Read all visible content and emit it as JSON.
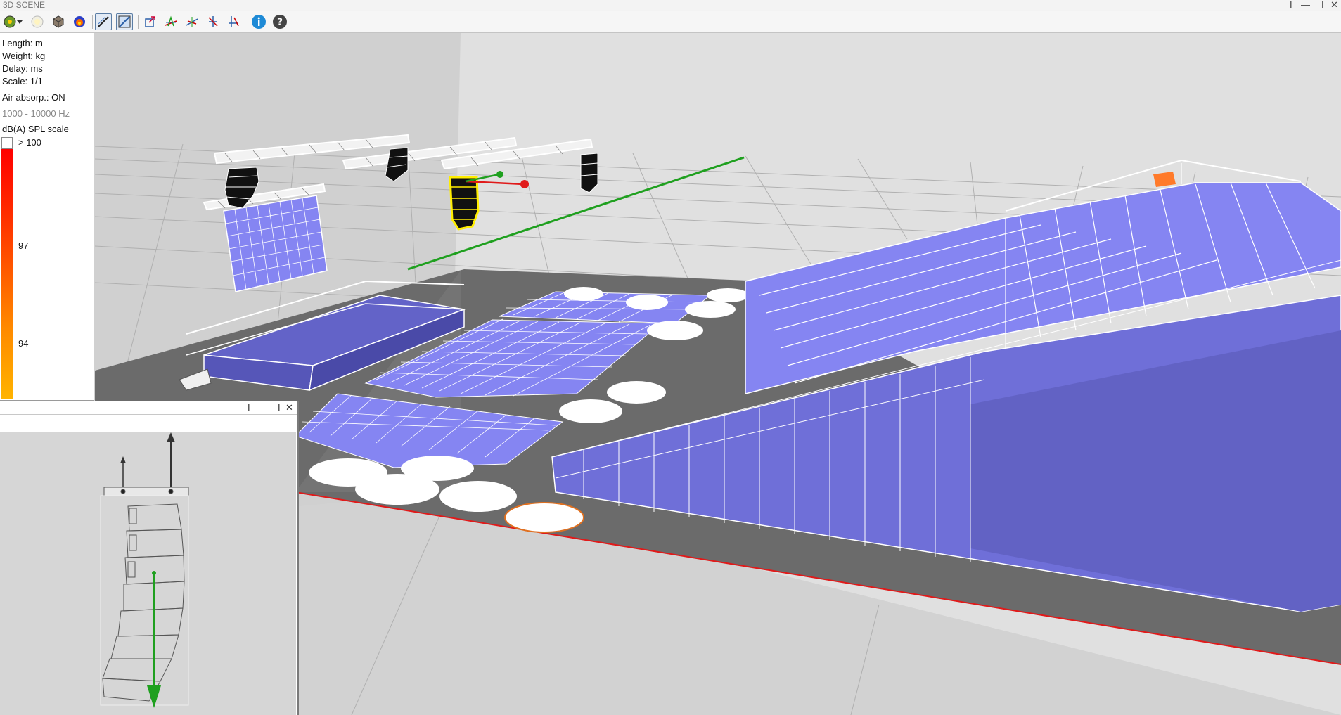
{
  "window": {
    "title": "3D SCENE",
    "controls": {
      "pin": "I",
      "minimize": "—",
      "restore": "I",
      "close": "✕"
    }
  },
  "toolbar": {
    "buttons": [
      {
        "name": "source-icon",
        "active": false
      },
      {
        "name": "dropdown-arrow-icon",
        "active": false
      },
      {
        "name": "light-icon",
        "active": false
      },
      {
        "name": "box-icon",
        "active": false
      },
      {
        "name": "spl-map-icon",
        "active": false
      },
      {
        "name": "view-line-icon",
        "active": true
      },
      {
        "name": "view-plane-icon",
        "active": true
      },
      {
        "name": "export-icon",
        "active": false
      },
      {
        "name": "axis-x-icon",
        "active": false
      },
      {
        "name": "axis-y-icon",
        "active": false
      },
      {
        "name": "pick-icon",
        "active": false
      },
      {
        "name": "pick-arrow-icon",
        "active": false
      },
      {
        "name": "info-icon",
        "active": false
      },
      {
        "name": "help-icon",
        "active": false
      }
    ]
  },
  "legend": {
    "length": "Length: m",
    "weight": "Weight: kg",
    "delay": "Delay: ms",
    "scale": "Scale: 1/1",
    "air_absorption": "Air absorp.: ON",
    "frequency_range": "1000 - 10000 Hz",
    "spl_title": "dB(A) SPL scale",
    "spl_ticks": [
      "> 100",
      "97",
      "94"
    ],
    "colors": {
      "high": "#ff0000",
      "low": "#ffb300"
    }
  },
  "subwindow": {
    "controls": {
      "pin": "I",
      "minimize": "—",
      "restore": "I",
      "close": "✕"
    }
  },
  "colors": {
    "seat_fill": "#8585f2",
    "floor": "#6a6a6a",
    "highlight": "#ffee00",
    "axis_red": "#e01a1a",
    "axis_green": "#1fa01f"
  }
}
